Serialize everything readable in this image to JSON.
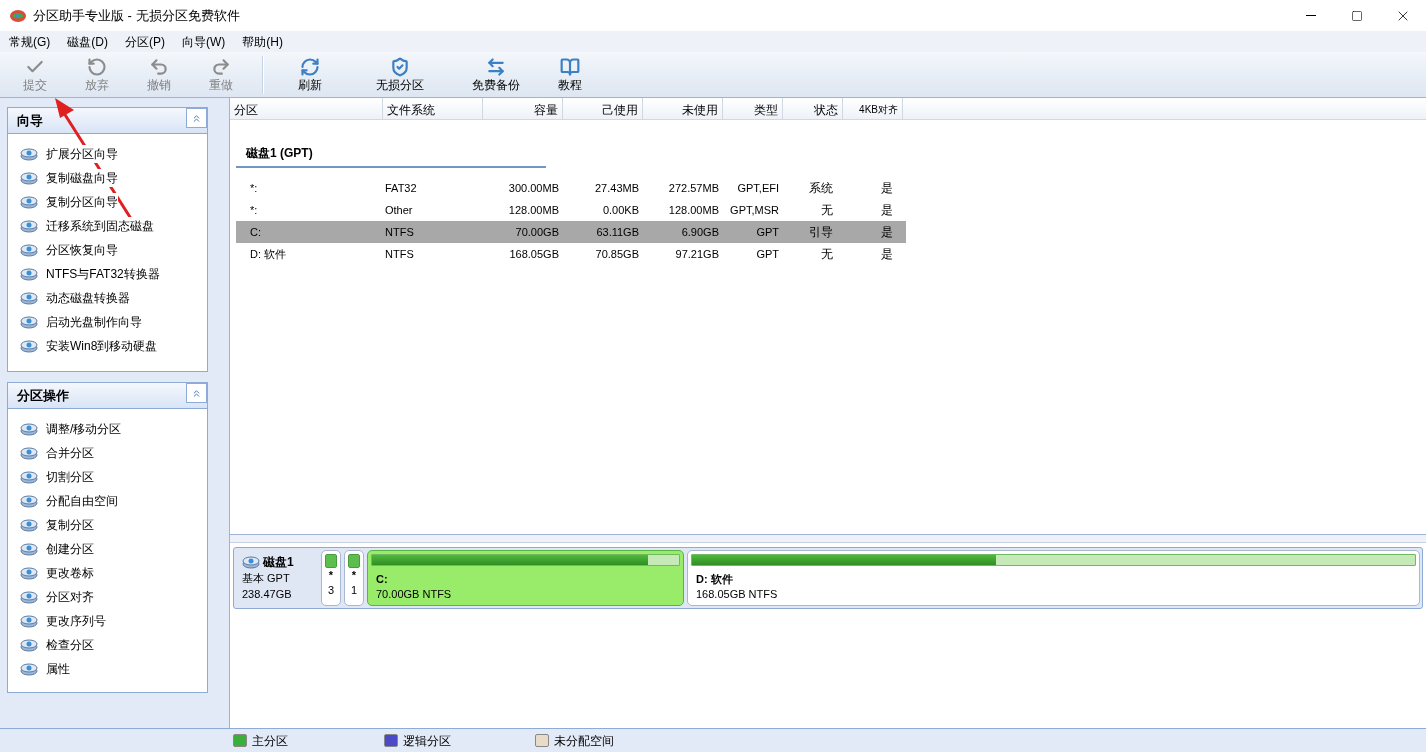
{
  "window": {
    "title": "分区助手专业版 - 无损分区免费软件"
  },
  "menu": [
    "常规(G)",
    "磁盘(D)",
    "分区(P)",
    "向导(W)",
    "帮助(H)"
  ],
  "toolbar": [
    {
      "label": "提交",
      "disabled": true
    },
    {
      "label": "放弃",
      "disabled": true
    },
    {
      "label": "撤销",
      "disabled": true
    },
    {
      "label": "重做",
      "disabled": true
    },
    {
      "label": "刷新",
      "disabled": false
    },
    {
      "label": "无损分区",
      "disabled": false
    },
    {
      "label": "免费备份",
      "disabled": false
    },
    {
      "label": "教程",
      "disabled": false
    }
  ],
  "sidebar": [
    {
      "title": "向导",
      "expanded": true,
      "items": [
        "扩展分区向导",
        "复制磁盘向导",
        "复制分区向导",
        "迁移系统到固态磁盘",
        "分区恢复向导",
        "NTFS与FAT32转换器",
        "动态磁盘转换器",
        "启动光盘制作向导",
        "安装Win8到移动硬盘"
      ]
    },
    {
      "title": "分区操作",
      "expanded": true,
      "items": [
        "调整/移动分区",
        "合并分区",
        "切割分区",
        "分配自由空间",
        "复制分区",
        "创建分区",
        "更改卷标",
        "分区对齐",
        "更改序列号",
        "检查分区",
        "属性"
      ]
    }
  ],
  "table": {
    "columns": [
      "分区",
      "文件系统",
      "容量",
      "己使用",
      "未使用",
      "类型",
      "状态",
      "4KB对齐"
    ],
    "disk_title": "磁盘1 (GPT)",
    "rows": [
      {
        "cells": [
          "*:",
          "FAT32",
          "300.00MB",
          "27.43MB",
          "272.57MB",
          "GPT,EFI",
          "系统",
          "是"
        ],
        "selected": false
      },
      {
        "cells": [
          "*:",
          "Other",
          "128.00MB",
          "0.00KB",
          "128.00MB",
          "GPT,MSR",
          "无",
          "是"
        ],
        "selected": false
      },
      {
        "cells": [
          "C:",
          "NTFS",
          "70.00GB",
          "63.11GB",
          "6.90GB",
          "GPT",
          "引导",
          "是"
        ],
        "selected": true
      },
      {
        "cells": [
          "D: 软件",
          "NTFS",
          "168.05GB",
          "70.85GB",
          "97.21GB",
          "GPT",
          "无",
          "是"
        ],
        "selected": false
      }
    ]
  },
  "disk_map": {
    "name": "磁盘1",
    "type": "基本 GPT",
    "size": "238.47GB",
    "partitions": [
      {
        "kind": "small",
        "label": "*",
        "number": "3",
        "level": 1,
        "selected": false
      },
      {
        "kind": "small",
        "label": "*",
        "number": "1",
        "level": 1,
        "selected": false
      },
      {
        "kind": "large",
        "label": "C:",
        "detail": "70.00GB NTFS",
        "level": 0.9,
        "selected": true
      },
      {
        "kind": "large",
        "label": "D: 软件",
        "detail": "168.05GB NTFS",
        "level": 0.42,
        "selected": false
      }
    ]
  },
  "legend": [
    {
      "label": "主分区",
      "color": "#3cae3c"
    },
    {
      "label": "逻辑分区",
      "color": "#4a4ac8"
    },
    {
      "label": "未分配空间",
      "color": "#e8dcc8"
    }
  ]
}
